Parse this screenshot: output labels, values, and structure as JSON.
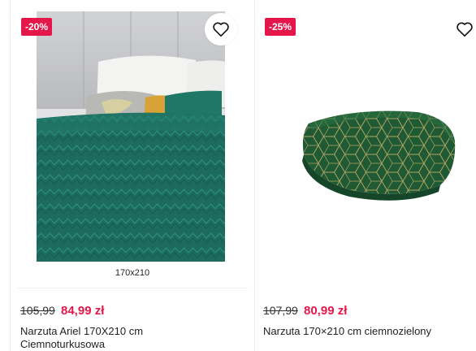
{
  "products": [
    {
      "discount": "-20%",
      "size_label": "170x210",
      "old_price": "105,99",
      "new_price": "84,99 zł",
      "title": "Narzuta Ariel 170X210 cm Ciemnoturkusowa",
      "icons": {
        "wishlist": "heart-outline-icon"
      },
      "colors": {
        "badge": "#e5174a",
        "price": "#e5174a",
        "product": "#1c6b5c"
      }
    },
    {
      "discount": "-25%",
      "old_price": "107,99",
      "new_price": "80,99 zł",
      "title": "Narzuta 170×210 cm ciemnozielony",
      "icons": {
        "wishlist": "heart-outline-icon"
      },
      "colors": {
        "badge": "#e5174a",
        "price": "#e5174a",
        "product": "#1f5a34"
      }
    }
  ]
}
